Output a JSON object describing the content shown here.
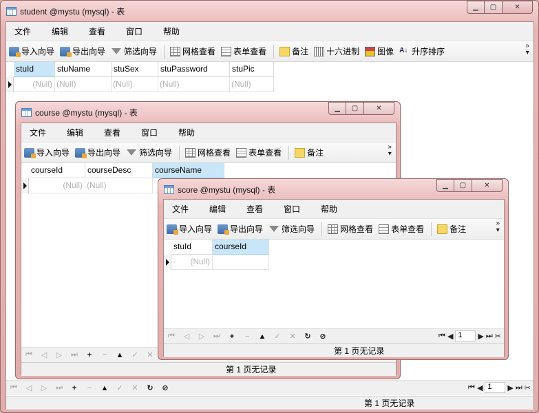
{
  "student": {
    "title": "student @mystu (mysql) - 表",
    "menu": [
      "文件",
      "编辑",
      "查看",
      "窗口",
      "帮助"
    ],
    "toolbar": {
      "import": "导入向导",
      "export": "导出向导",
      "filter": "筛选向导",
      "grid": "网格查看",
      "form": "表单查看",
      "memo": "备注",
      "hex": "十六进制",
      "image": "图像",
      "sort": "升序排序"
    },
    "columns": [
      "stuId",
      "stuName",
      "stuSex",
      "stuPassword",
      "stuPic"
    ],
    "row": [
      "(Null)",
      "(Null)",
      "(Null)",
      "(Null)",
      "(Null)"
    ],
    "page": "1",
    "status": "第 1 页无记录"
  },
  "course": {
    "title": "course @mystu (mysql) - 表",
    "menu": [
      "文件",
      "编辑",
      "查看",
      "窗口",
      "帮助"
    ],
    "toolbar": {
      "import": "导入向导",
      "export": "导出向导",
      "filter": "筛选向导",
      "grid": "网格查看",
      "form": "表单查看",
      "memo": "备注"
    },
    "columns": [
      "courseId",
      "courseDesc",
      "courseName"
    ],
    "row": [
      "(Null)",
      "(Null)",
      ""
    ],
    "status": "第 1 页无记录"
  },
  "score": {
    "title": "score @mystu (mysql) - 表",
    "menu": [
      "文件",
      "编辑",
      "查看",
      "窗口",
      "帮助"
    ],
    "toolbar": {
      "import": "导入向导",
      "export": "导出向导",
      "filter": "筛选向导",
      "grid": "网格查看",
      "form": "表单查看",
      "memo": "备注"
    },
    "columns": [
      "stuId",
      "courseId"
    ],
    "row": [
      "(Null)",
      ""
    ],
    "page": "1",
    "status": "第 1 页无记录"
  }
}
